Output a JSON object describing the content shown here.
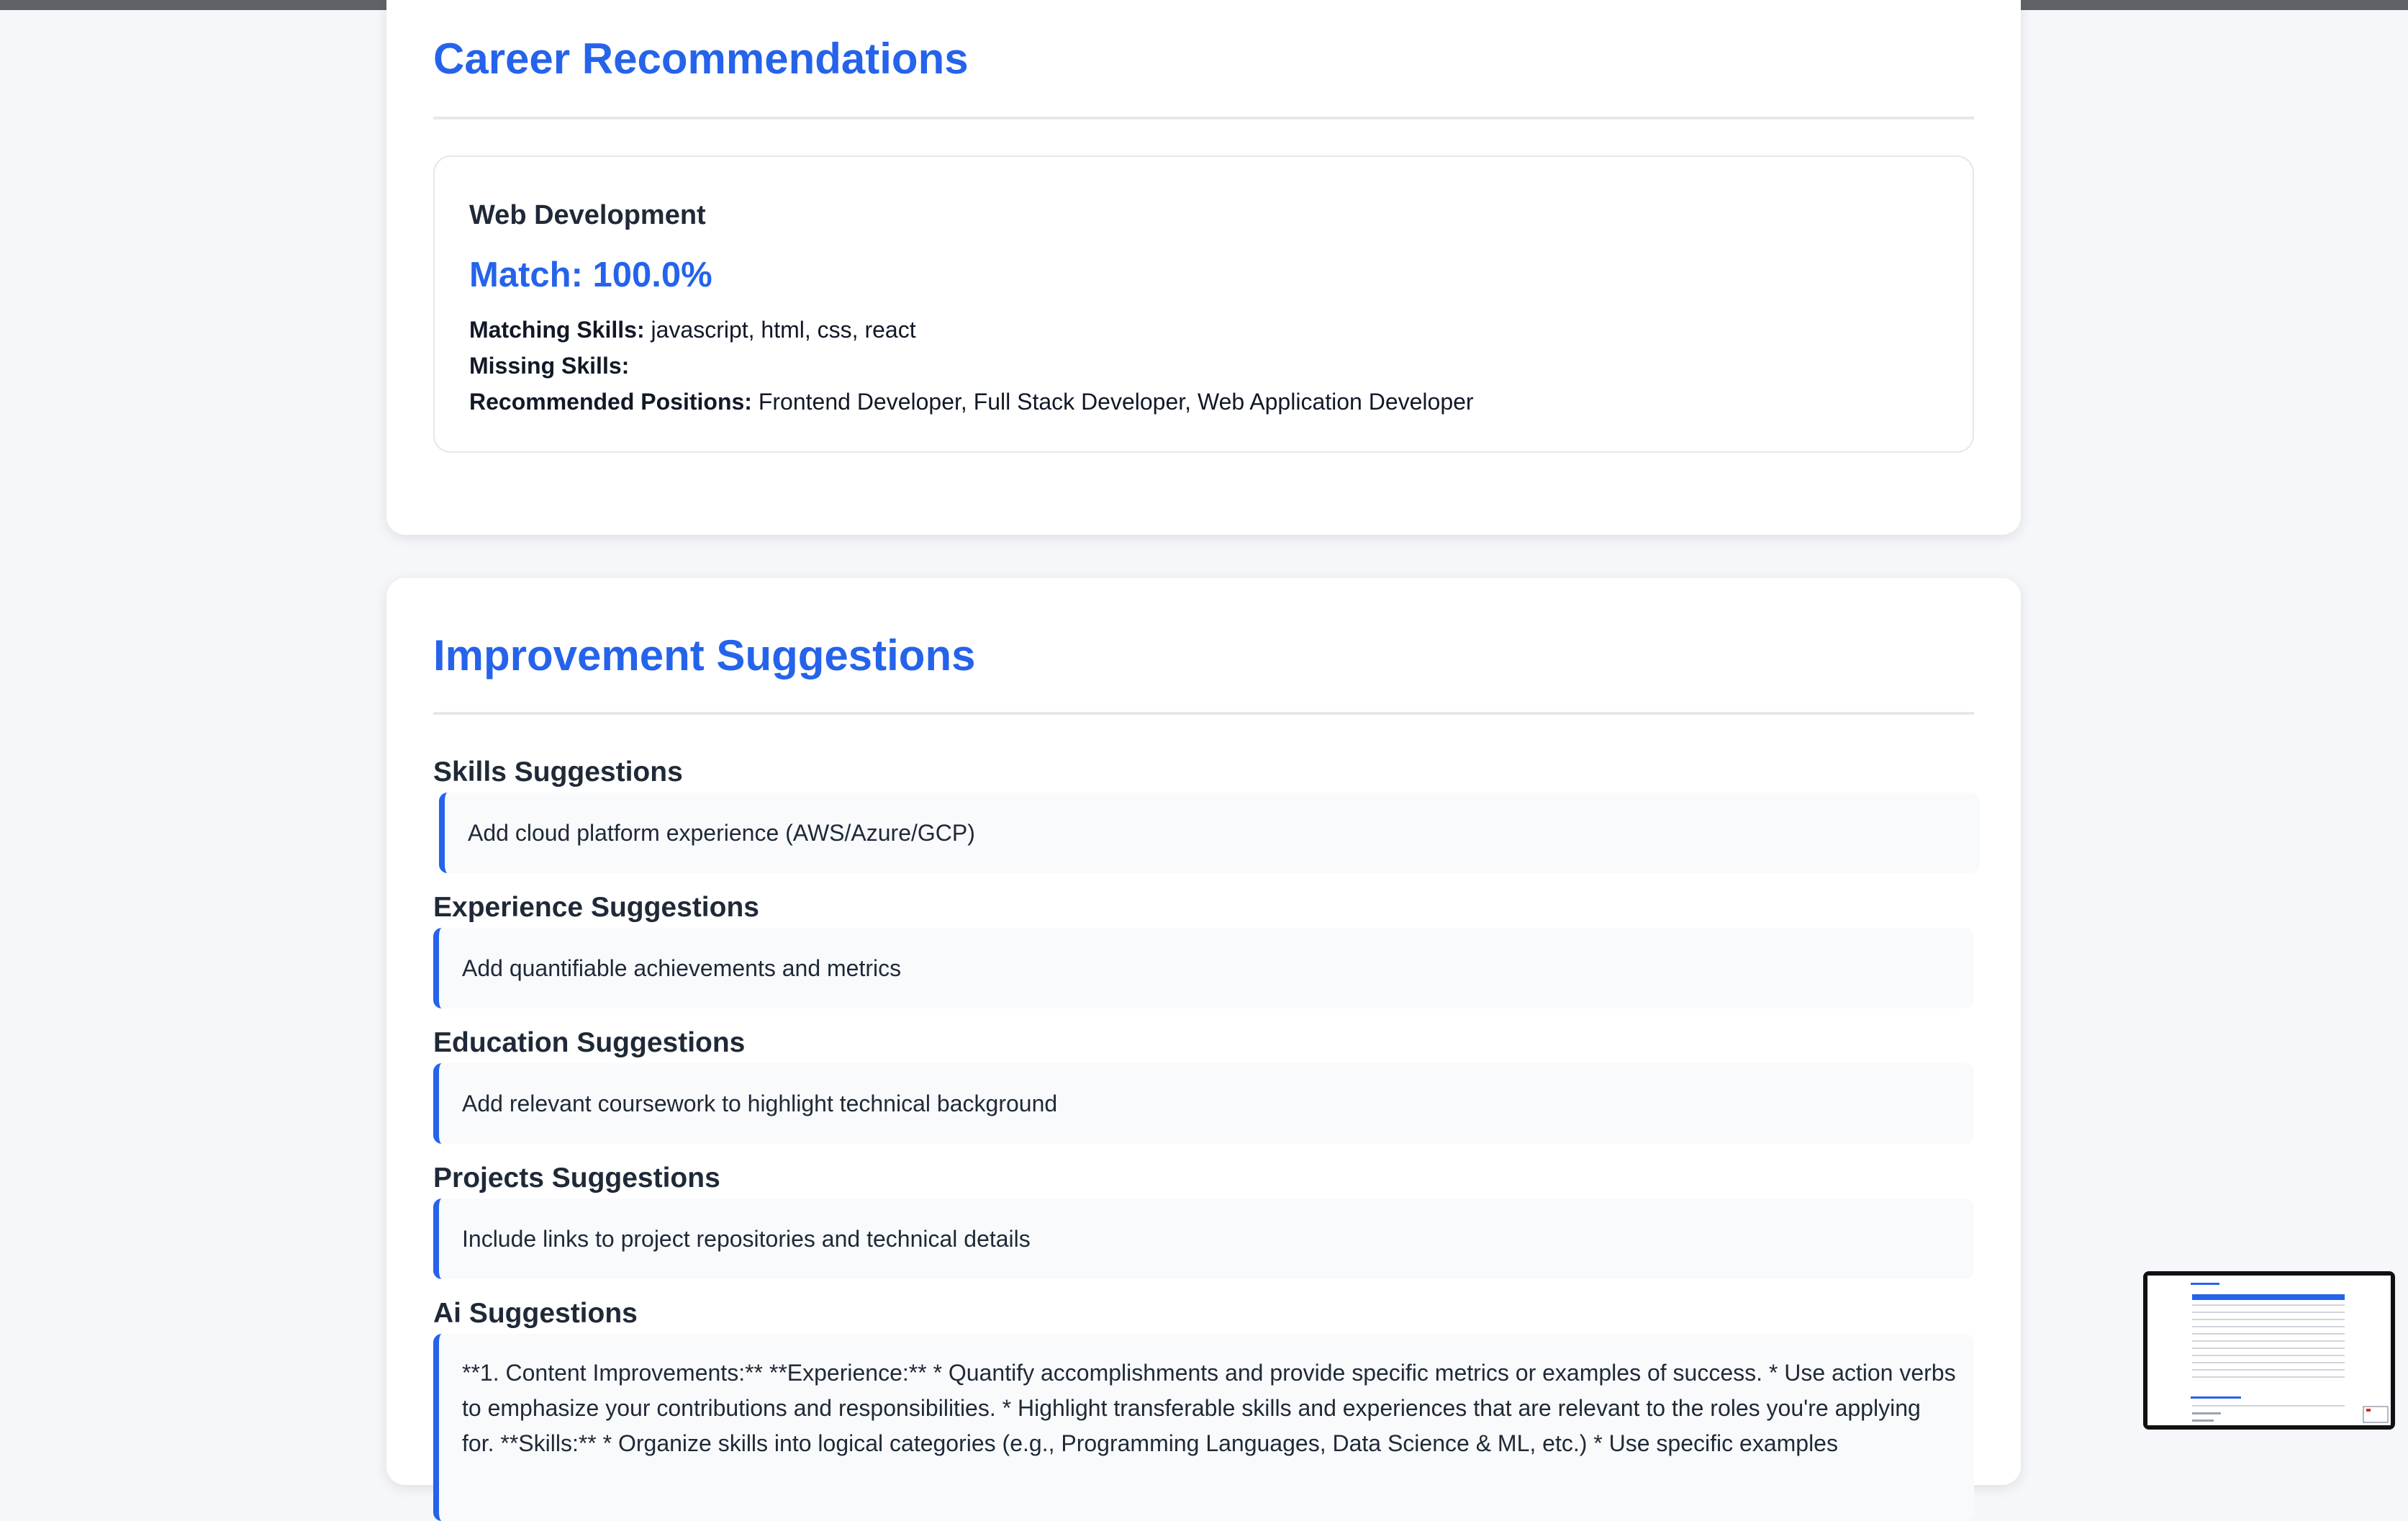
{
  "career": {
    "title": "Career Recommendations",
    "item": {
      "title": "Web Development",
      "match": "Match: 100.0%",
      "matching_label": "Matching Skills:",
      "matching_value": "javascript, html, css, react",
      "missing_label": "Missing Skills:",
      "missing_value": "",
      "positions_label": "Recommended Positions:",
      "positions_value": "Frontend Developer, Full Stack Developer, Web Application Developer"
    }
  },
  "improvement": {
    "title": "Improvement Suggestions",
    "skills": {
      "heading": "Skills Suggestions",
      "text": "Add cloud platform experience (AWS/Azure/GCP)"
    },
    "experience": {
      "heading": "Experience Suggestions",
      "text": "Add quantifiable achievements and metrics"
    },
    "education": {
      "heading": "Education Suggestions",
      "text": "Add relevant coursework to highlight technical background"
    },
    "projects": {
      "heading": "Projects Suggestions",
      "text": "Include links to project repositories and technical details"
    },
    "ai": {
      "heading": "Ai Suggestions",
      "text": "**1. Content Improvements:** **Experience:** * Quantify accomplishments and provide specific metrics or examples of success. * Use action verbs to emphasize your contributions and responsibilities. * Highlight transferable skills and experiences that are relevant to the roles you're applying for. **Skills:** * Organize skills into logical categories (e.g., Programming Languages, Data Science & ML, etc.) * Use specific examples"
    }
  },
  "colors": {
    "accent": "#2563eb",
    "page_bg": "#f5f7fb",
    "card_bg": "#ffffff"
  }
}
